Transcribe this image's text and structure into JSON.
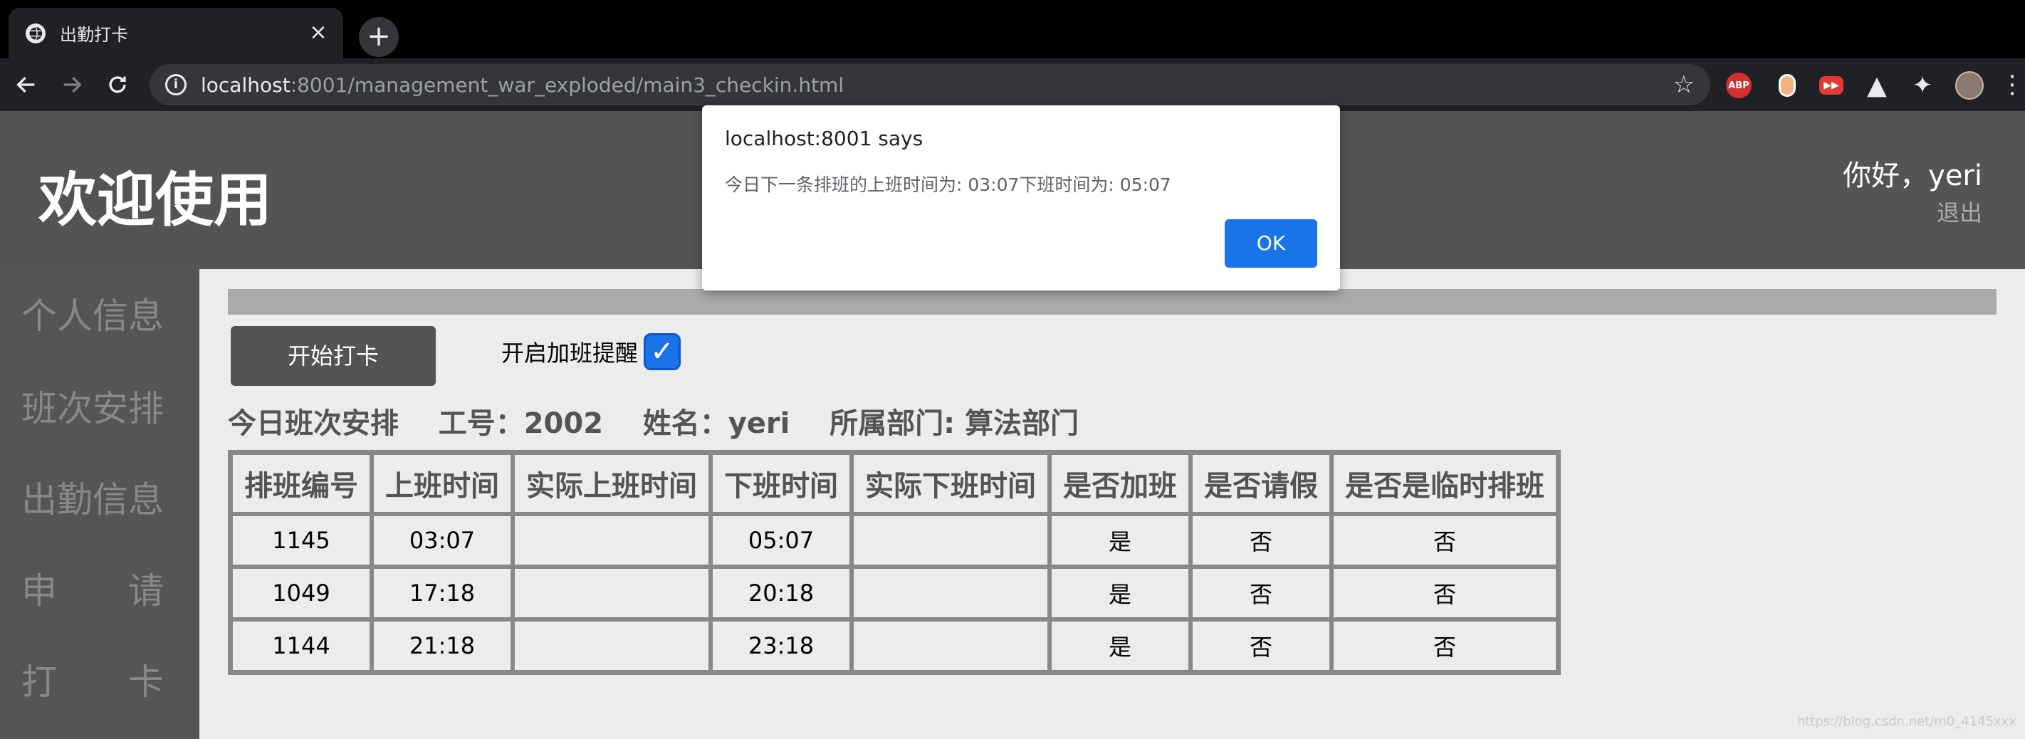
{
  "browser": {
    "tab_title": "出勤打卡",
    "url_host": "localhost",
    "url_rest": ":8001/management_war_exploded/main3_checkin.html"
  },
  "header": {
    "title": "欢迎使用",
    "greeting": "你好，yeri",
    "logout": "退出"
  },
  "sidebar": {
    "items": [
      {
        "label": "个人信息"
      },
      {
        "label": "班次安排"
      },
      {
        "label": "出勤信息"
      },
      {
        "label_a": "申",
        "label_b": "请"
      },
      {
        "label_a": "打",
        "label_b": "卡"
      }
    ]
  },
  "main": {
    "checkin_button": "开始打卡",
    "overtime_label": "开启加班提醒",
    "overtime_checked": true,
    "info_line": "今日班次安排    工号：2002    姓名：yeri    所属部门: 算法部门",
    "table": {
      "headers": [
        "排班编号",
        "上班时间",
        "实际上班时间",
        "下班时间",
        "实际下班时间",
        "是否加班",
        "是否请假",
        "是否是临时排班"
      ],
      "rows": [
        [
          "1145",
          "03:07",
          "",
          "05:07",
          "",
          "是",
          "否",
          "否"
        ],
        [
          "1049",
          "17:18",
          "",
          "20:18",
          "",
          "是",
          "否",
          "否"
        ],
        [
          "1144",
          "21:18",
          "",
          "23:18",
          "",
          "是",
          "否",
          "否"
        ]
      ]
    }
  },
  "dialog": {
    "title": "localhost:8001 says",
    "message": "今日下一条排班的上班时间为: 03:07下班时间为: 05:07",
    "ok": "OK"
  },
  "watermark": "https://blog.csdn.net/m0_4145xxx",
  "colors": {
    "header_bg": "#545454",
    "sidebar_bg": "#555555",
    "content_bg": "#ececec",
    "accent": "#1a73e8"
  }
}
